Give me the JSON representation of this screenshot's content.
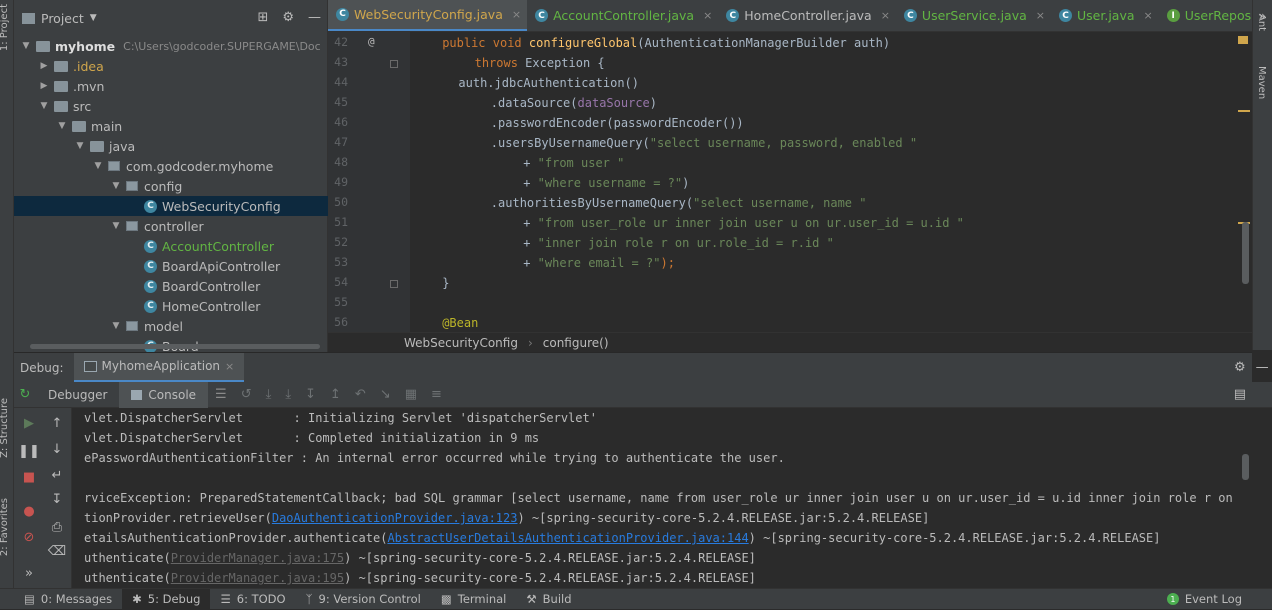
{
  "left_strip": {
    "project": "1: Project",
    "structure": "Z: Structure",
    "favorites": "2: Favorites"
  },
  "right_strip": {
    "ant": "Ant",
    "maven": "Maven"
  },
  "project_panel": {
    "title": "Project",
    "tree": [
      {
        "label": "myhome",
        "path": "C:\\Users\\godcoder.SUPERGAME\\Doc",
        "type": "module",
        "depth": 0,
        "expanded": true
      },
      {
        "label": ".idea",
        "type": "folder",
        "depth": 1,
        "expanded": false,
        "color": "#d0a64c"
      },
      {
        "label": ".mvn",
        "type": "folder",
        "depth": 1,
        "expanded": false
      },
      {
        "label": "src",
        "type": "folder",
        "depth": 1,
        "expanded": true
      },
      {
        "label": "main",
        "type": "folder",
        "depth": 2,
        "expanded": true
      },
      {
        "label": "java",
        "type": "folder",
        "depth": 3,
        "expanded": true
      },
      {
        "label": "com.godcoder.myhome",
        "type": "package",
        "depth": 4,
        "expanded": true
      },
      {
        "label": "config",
        "type": "package",
        "depth": 5,
        "expanded": true
      },
      {
        "label": "WebSecurityConfig",
        "type": "class",
        "depth": 6,
        "selected": true
      },
      {
        "label": "controller",
        "type": "package",
        "depth": 5,
        "expanded": true
      },
      {
        "label": "AccountController",
        "type": "class",
        "depth": 6,
        "color": "#62b543"
      },
      {
        "label": "BoardApiController",
        "type": "class",
        "depth": 6
      },
      {
        "label": "BoardController",
        "type": "class",
        "depth": 6
      },
      {
        "label": "HomeController",
        "type": "class",
        "depth": 6
      },
      {
        "label": "model",
        "type": "package",
        "depth": 5,
        "expanded": true
      },
      {
        "label": "Board",
        "type": "class",
        "depth": 6
      }
    ]
  },
  "editor_tabs": [
    {
      "label": "WebSecurityConfig.java",
      "icon": "class-icon",
      "active": true,
      "color": "#d0a64c"
    },
    {
      "label": "AccountController.java",
      "icon": "class-icon",
      "color": "#62b543"
    },
    {
      "label": "HomeController.java",
      "icon": "class-icon"
    },
    {
      "label": "UserService.java",
      "icon": "class-icon",
      "color": "#62b543"
    },
    {
      "label": "User.java",
      "icon": "class-icon",
      "color": "#62b543"
    },
    {
      "label": "UserRepository.java",
      "icon": "interface-icon",
      "color": "#62b543"
    }
  ],
  "tab_overflow": "»",
  "code": {
    "lines": [
      {
        "n": "42",
        "indent": 1,
        "parts": [
          [
            "kw",
            "public void "
          ],
          [
            "fn",
            "configureGlobal"
          ],
          [
            "par",
            "(AuthenticationManagerBuilder auth)"
          ]
        ],
        "marker": "@"
      },
      {
        "n": "43",
        "indent": 3,
        "parts": [
          [
            "kw",
            "throws "
          ],
          [
            "par",
            "Exception {"
          ]
        ]
      },
      {
        "n": "44",
        "indent": 2,
        "parts": [
          [
            "par",
            "auth.jdbcAuthentication()"
          ]
        ]
      },
      {
        "n": "45",
        "indent": 4,
        "parts": [
          [
            "par",
            "."
          ],
          [
            "par",
            "dataSource("
          ],
          [
            "fn2",
            "dataSource"
          ],
          [
            "par",
            ")"
          ]
        ]
      },
      {
        "n": "46",
        "indent": 4,
        "parts": [
          [
            "par",
            ".passwordEncoder(passwordEncoder())"
          ]
        ]
      },
      {
        "n": "47",
        "indent": 4,
        "parts": [
          [
            "par",
            ".usersByUsernameQuery("
          ],
          [
            "str",
            "\"select username, password, enabled \""
          ]
        ]
      },
      {
        "n": "48",
        "indent": 6,
        "parts": [
          [
            "par",
            "+ "
          ],
          [
            "str",
            "\"from user \""
          ]
        ]
      },
      {
        "n": "49",
        "indent": 6,
        "parts": [
          [
            "par",
            "+ "
          ],
          [
            "str",
            "\"where username = ?\""
          ],
          [
            "par",
            ")"
          ]
        ]
      },
      {
        "n": "50",
        "indent": 4,
        "parts": [
          [
            "par",
            ".authoritiesByUsernameQuery("
          ],
          [
            "str",
            "\"select username, name \""
          ]
        ]
      },
      {
        "n": "51",
        "indent": 6,
        "parts": [
          [
            "par",
            "+ "
          ],
          [
            "str",
            "\"from user_role ur inner join user u on ur.user_id = u.id \""
          ]
        ]
      },
      {
        "n": "52",
        "indent": 6,
        "parts": [
          [
            "par",
            "+ "
          ],
          [
            "str",
            "\"inner join role r on ur.role_id = r.id \""
          ]
        ]
      },
      {
        "n": "53",
        "indent": 6,
        "parts": [
          [
            "par",
            "+ "
          ],
          [
            "str",
            "\"where email = ?\""
          ],
          [
            "kw",
            ");"
          ]
        ]
      },
      {
        "n": "54",
        "indent": 1,
        "parts": [
          [
            "par",
            "}"
          ]
        ]
      },
      {
        "n": "55",
        "indent": 0,
        "parts": []
      },
      {
        "n": "56",
        "indent": 1,
        "parts": [
          [
            "ann",
            "@Bean"
          ]
        ]
      }
    ]
  },
  "breadcrumb": {
    "class": "WebSecurityConfig",
    "method": "configure()"
  },
  "debug": {
    "label": "Debug:",
    "run_config": "MyhomeApplication",
    "tabs": {
      "debugger": "Debugger",
      "console": "Console"
    },
    "console_lines": [
      [
        [
          "t",
          "vlet.DispatcherServlet       : Initializing Servlet 'dispatcherServlet'"
        ]
      ],
      [
        [
          "t",
          "vlet.DispatcherServlet       : Completed initialization in 9 ms"
        ]
      ],
      [
        [
          "t",
          "ePasswordAuthenticationFilter : An internal error occurred while trying to authenticate the user."
        ]
      ],
      [],
      [
        [
          "t",
          "rviceException: PreparedStatementCallback; bad SQL grammar [select username, name from user_role ur inner join user u on ur.user_id = u.id inner join role r on ur.role_id = r."
        ]
      ],
      [
        [
          "t",
          "tionProvider.retrieveUser("
        ],
        [
          "l",
          "DaoAuthenticationProvider.java:123"
        ],
        [
          "t",
          ") ~[spring-security-core-5.2.4.RELEASE.jar:5.2.4.RELEASE]"
        ]
      ],
      [
        [
          "t",
          "etailsAuthenticationProvider.authenticate("
        ],
        [
          "l",
          "AbstractUserDetailsAuthenticationProvider.java:144"
        ],
        [
          "t",
          ") ~[spring-security-core-5.2.4.RELEASE.jar:5.2.4.RELEASE]"
        ]
      ],
      [
        [
          "t",
          "uthenticate("
        ],
        [
          "g",
          "ProviderManager.java:175"
        ],
        [
          "t",
          ") ~[spring-security-core-5.2.4.RELEASE.jar:5.2.4.RELEASE]"
        ]
      ],
      [
        [
          "t",
          "uthenticate("
        ],
        [
          "g",
          "ProviderManager.java:195"
        ],
        [
          "t",
          ") ~[spring-security-core-5.2.4.RELEASE.jar:5.2.4.RELEASE]"
        ]
      ]
    ]
  },
  "statusbar": {
    "messages": "0: Messages",
    "debug": "5: Debug",
    "todo": "6: TODO",
    "vcs": "9: Version Control",
    "terminal": "Terminal",
    "build": "Build",
    "event_log": "Event Log"
  }
}
